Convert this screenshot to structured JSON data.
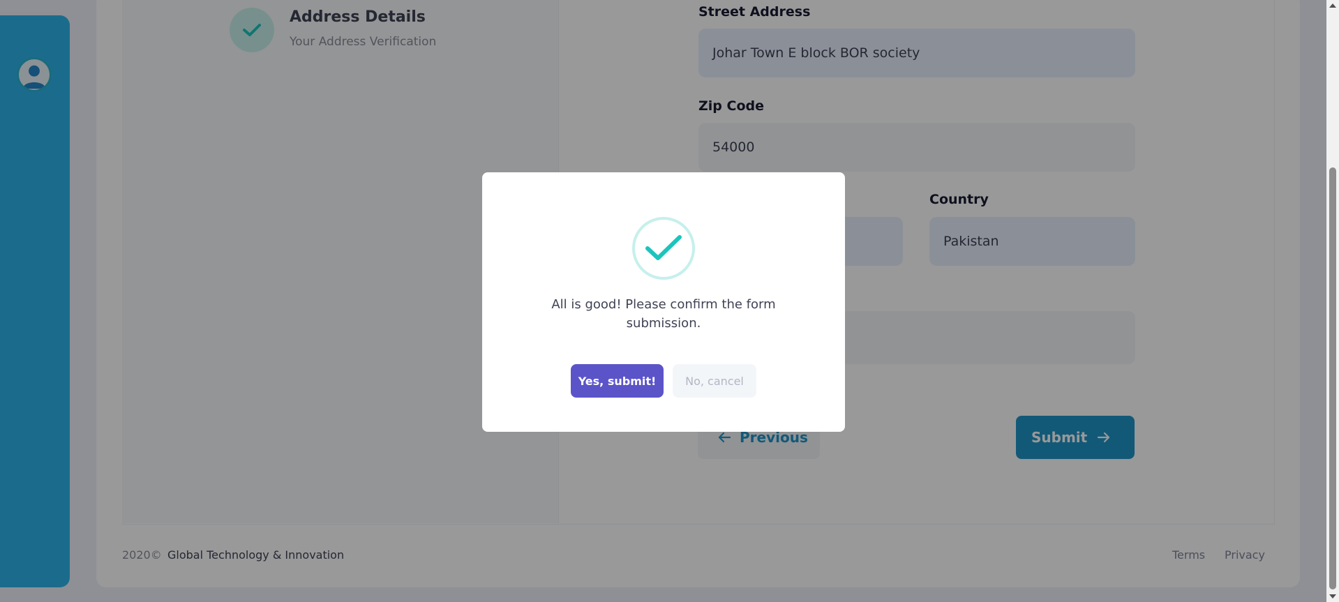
{
  "wizard": {
    "step": {
      "title": "Address Details",
      "subtitle": "Your Address Verification"
    },
    "fields": {
      "street_label": "Street Address",
      "street_value": "Johar Town E block BOR society",
      "zip_label": "Zip Code",
      "zip_value": "54000",
      "country_label": "Country",
      "country_value": "Pakistan"
    },
    "buttons": {
      "previous": "Previous",
      "submit": "Submit"
    }
  },
  "footer": {
    "year": "2020©",
    "company": "Global Technology & Innovation",
    "terms": "Terms",
    "privacy": "Privacy"
  },
  "dialog": {
    "message": "All is good! Please confirm the form submission.",
    "confirm": "Yes, submit!",
    "cancel": "No, cancel"
  },
  "colors": {
    "sidebar": "#2eb4ea",
    "primary": "#1f95c9",
    "confirm_button": "#5b54c8",
    "success": "#1bc5bd"
  }
}
